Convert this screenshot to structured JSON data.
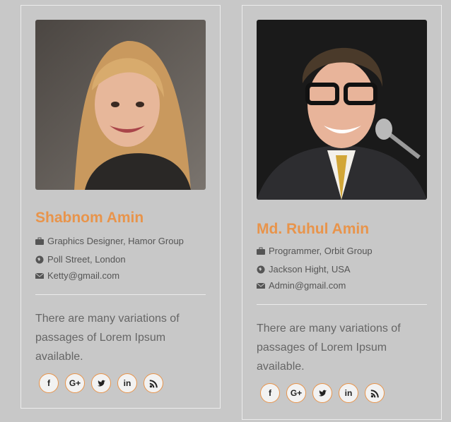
{
  "colors": {
    "accent": "#e8944b",
    "background": "#c8c8c8",
    "text": "#555555"
  },
  "team": [
    {
      "name": "Shabnom Amin",
      "job": "Graphics Designer, Hamor Group",
      "location": "Poll Street, London",
      "email": "Ketty@gmail.com",
      "bio": "There are many variations of passages of Lorem Ipsum available.",
      "socials": [
        {
          "icon": "facebook-icon",
          "glyph": "f"
        },
        {
          "icon": "google-plus-icon",
          "glyph": "G+"
        },
        {
          "icon": "twitter-icon",
          "glyph": ""
        },
        {
          "icon": "linkedin-icon",
          "glyph": "in"
        },
        {
          "icon": "rss-icon",
          "glyph": ""
        }
      ]
    },
    {
      "name": "Md. Ruhul Amin",
      "job": "Programmer, Orbit Group",
      "location": "Jackson Hight, USA",
      "email": "Admin@gmail.com",
      "bio": "There are many variations of passages of Lorem Ipsum available.",
      "socials": [
        {
          "icon": "facebook-icon",
          "glyph": "f"
        },
        {
          "icon": "google-plus-icon",
          "glyph": "G+"
        },
        {
          "icon": "twitter-icon",
          "glyph": ""
        },
        {
          "icon": "linkedin-icon",
          "glyph": "in"
        },
        {
          "icon": "rss-icon",
          "glyph": ""
        }
      ]
    }
  ]
}
